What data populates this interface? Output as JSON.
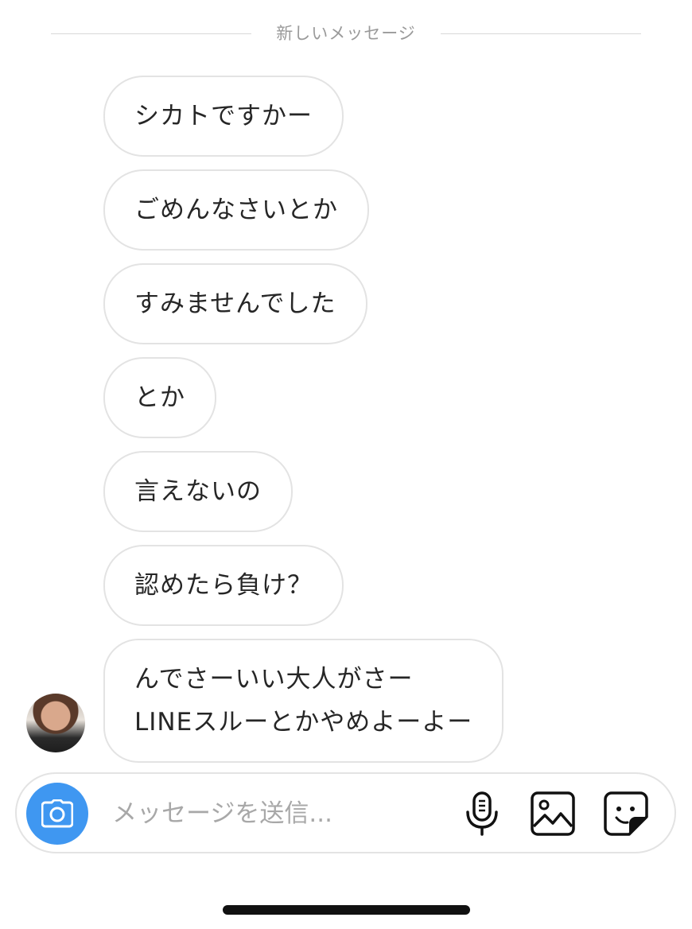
{
  "divider": {
    "label": "新しいメッセージ"
  },
  "messages": [
    "シカトですかー",
    "ごめんなさいとか",
    "すみませんでした",
    "とか",
    "言えないの",
    "認めたら負け？",
    "んでさーいい大人がさー\nLINEスルーとかやめよーよー"
  ],
  "composer": {
    "placeholder": "メッセージを送信..."
  },
  "icons": {
    "camera": "camera-icon",
    "microphone": "microphone-icon",
    "gallery": "gallery-icon",
    "sticker": "sticker-icon"
  },
  "colors": {
    "camera_button": "#3f97f1",
    "bubble_border": "#e3e3e3",
    "divider_text": "#9a9a9a"
  }
}
